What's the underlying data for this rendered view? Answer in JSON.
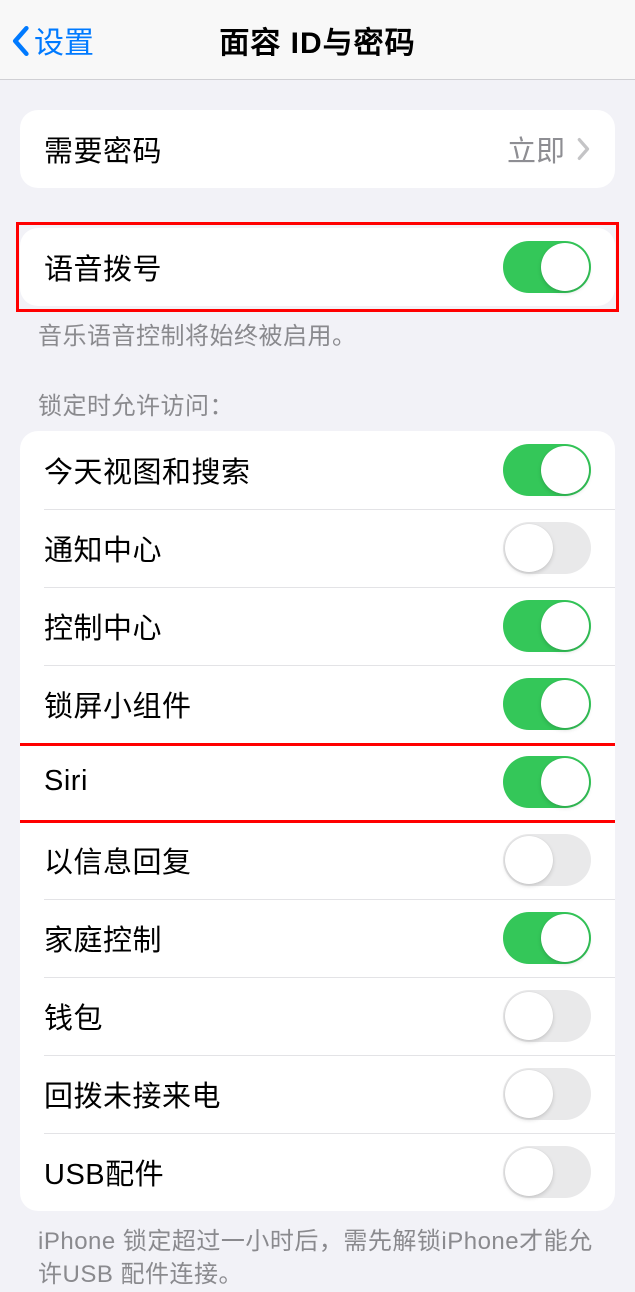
{
  "header": {
    "back_label": "设置",
    "title": "面容 ID与密码"
  },
  "passcode_row": {
    "label": "需要密码",
    "value": "立即"
  },
  "voice_dial": {
    "label": "语音拨号",
    "on": true,
    "footer": "音乐语音控制将始终被启用。"
  },
  "lock_section": {
    "header": "锁定时允许访问：",
    "items": [
      {
        "label": "今天视图和搜索",
        "on": true,
        "highlight": false
      },
      {
        "label": "通知中心",
        "on": false,
        "highlight": false
      },
      {
        "label": "控制中心",
        "on": true,
        "highlight": false
      },
      {
        "label": "锁屏小组件",
        "on": true,
        "highlight": false
      },
      {
        "label": "Siri",
        "on": true,
        "highlight": true
      },
      {
        "label": "以信息回复",
        "on": false,
        "highlight": false
      },
      {
        "label": "家庭控制",
        "on": true,
        "highlight": false
      },
      {
        "label": "钱包",
        "on": false,
        "highlight": false
      },
      {
        "label": "回拨未接来电",
        "on": false,
        "highlight": false
      },
      {
        "label": "USB配件",
        "on": false,
        "highlight": false
      }
    ],
    "footer": "iPhone 锁定超过一小时后，需先解锁iPhone才能允许USB 配件连接。"
  }
}
